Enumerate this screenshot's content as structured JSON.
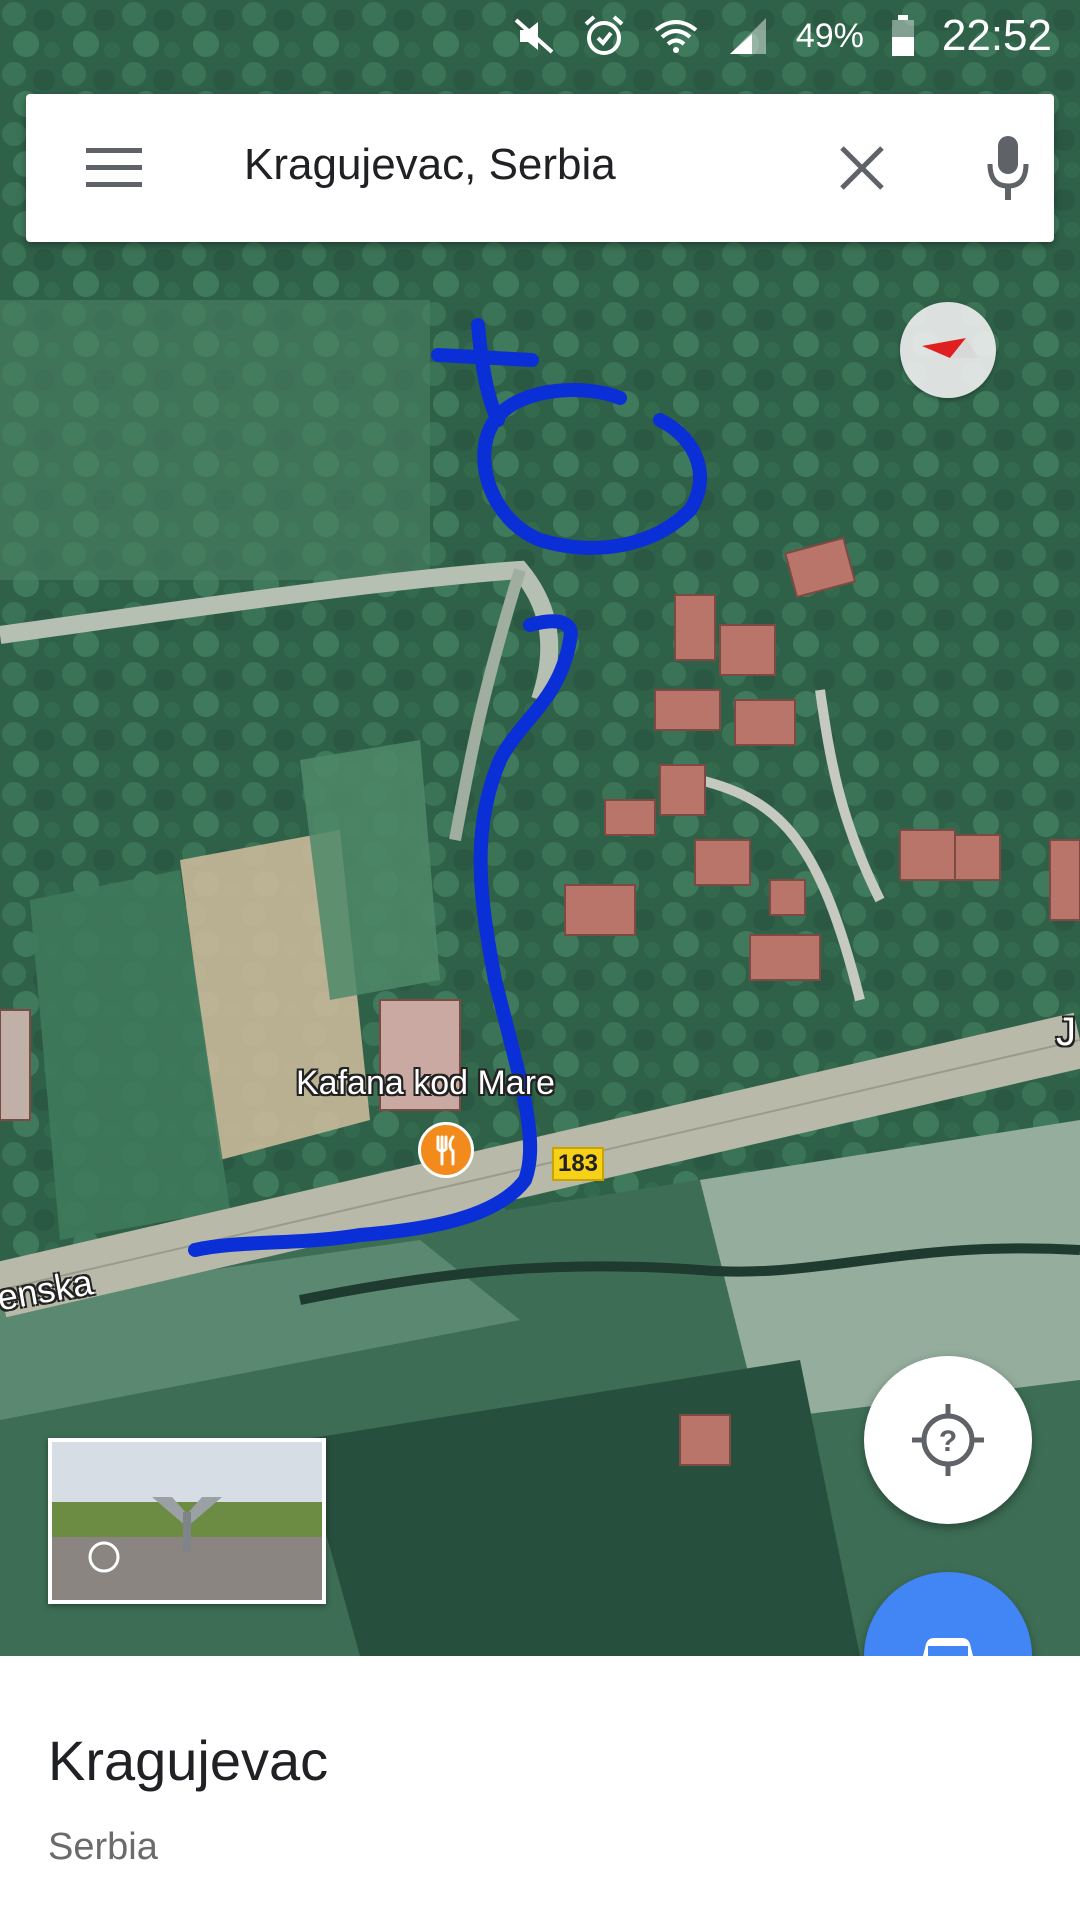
{
  "status_bar": {
    "battery_percent": "49%",
    "time": "22:52",
    "icons": [
      "mute-icon",
      "alarm-icon",
      "wifi-icon",
      "signal-icon",
      "battery-icon"
    ]
  },
  "search": {
    "query": "Kragujevac, Serbia",
    "icons": [
      "menu-icon",
      "close-icon",
      "microphone-icon"
    ]
  },
  "map": {
    "type": "satellite",
    "poi_name": "Kafana kod Mare",
    "poi_icon": "restaurant-icon",
    "poi_color": "#f28b1b",
    "road_number": "183",
    "street_label_fragment": "enska",
    "edge_label_fragment": "J",
    "annotation_color": "#0a2fd6"
  },
  "place": {
    "title": "Kragujevac",
    "subtitle": "Serbia"
  },
  "buttons": {
    "locate_icon": "my-location-unknown-icon",
    "directions_icon": "car-icon",
    "directions_color": "#4285f4"
  }
}
